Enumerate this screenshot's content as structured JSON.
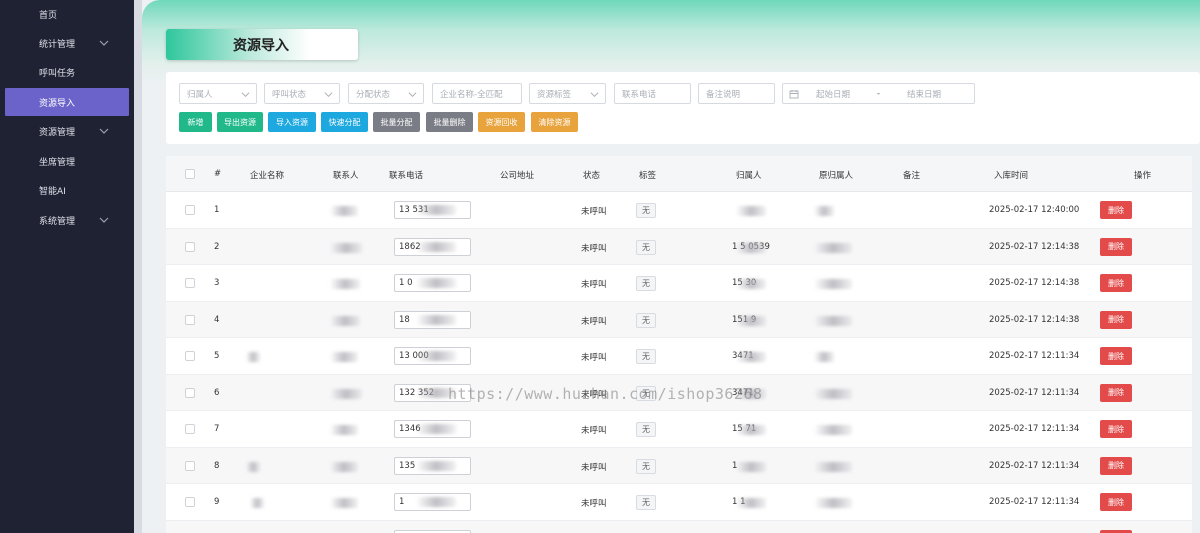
{
  "sidebar": {
    "items": [
      {
        "label": "首页",
        "has_chevron": false
      },
      {
        "label": "统计管理",
        "has_chevron": true
      },
      {
        "label": "呼叫任务",
        "has_chevron": false
      },
      {
        "label": "资源导入",
        "has_chevron": false,
        "active": true
      },
      {
        "label": "资源管理",
        "has_chevron": true
      },
      {
        "label": "坐席管理",
        "has_chevron": false
      },
      {
        "label": "智能AI",
        "has_chevron": false
      },
      {
        "label": "系统管理",
        "has_chevron": true
      }
    ]
  },
  "page": {
    "title": "资源导入"
  },
  "filters": {
    "owner": "归属人",
    "call_status": "呼叫状态",
    "assign_status": "分配状态",
    "company": "企业名称-全匹配",
    "resource_tag": "资源标签",
    "phone": "联系电话",
    "remark": "备注说明",
    "start_date": "起始日期",
    "date_sep": "-",
    "end_date": "结束日期"
  },
  "actions": {
    "add": "新增",
    "export": "导出资源",
    "import": "导入资源",
    "quick_assign": "快速分配",
    "batch_assign": "批量分配",
    "batch_delete": "批量删除",
    "recycle": "资源回收",
    "clear": "清除资源"
  },
  "colors": {
    "sidebar_bg": "#1f2233",
    "active_item": "#6b63c9",
    "btn_green": "#22b98a",
    "btn_blue": "#1ea8e0",
    "btn_gray": "#7a7d85",
    "btn_orange": "#e8a33d",
    "btn_red": "#e34b4b"
  },
  "table": {
    "headers": {
      "index": "#",
      "company": "企业名称",
      "contact": "联系人",
      "phone": "联系电话",
      "address": "公司地址",
      "status": "状态",
      "tag": "标签",
      "owner": "归属人",
      "orig_owner": "原归属人",
      "remark": "备注",
      "time": "入库时间",
      "ops": "操作"
    },
    "rows": [
      {
        "index": "1",
        "phone": "13    531",
        "status": "未呼叫",
        "tag": "无",
        "owner": "",
        "time": "2025-02-17 12:40:00",
        "op": "删除"
      },
      {
        "index": "2",
        "phone": "1862",
        "status": "未呼叫",
        "tag": "无",
        "owner": "1  5  0539",
        "time": "2025-02-17 12:14:38",
        "op": "删除"
      },
      {
        "index": "3",
        "phone": "1    0",
        "status": "未呼叫",
        "tag": "无",
        "owner": "15    30",
        "time": "2025-02-17 12:14:38",
        "op": "删除"
      },
      {
        "index": "4",
        "phone": "18",
        "status": "未呼叫",
        "tag": "无",
        "owner": "151    9",
        "time": "2025-02-17 12:14:38",
        "op": "删除"
      },
      {
        "index": "5",
        "phone": "13    000",
        "status": "未呼叫",
        "tag": "无",
        "owner": "   3471",
        "time": "2025-02-17 12:11:34",
        "op": "删除"
      },
      {
        "index": "6",
        "phone": "132    352",
        "status": "未呼叫",
        "tag": "无",
        "owner": "   3471",
        "time": "2025-02-17 12:11:34",
        "op": "删除"
      },
      {
        "index": "7",
        "phone": "1346",
        "status": "未呼叫",
        "tag": "无",
        "owner": "15    71",
        "time": "2025-02-17 12:11:34",
        "op": "删除"
      },
      {
        "index": "8",
        "phone": "135",
        "status": "未呼叫",
        "tag": "无",
        "owner": "      1",
        "time": "2025-02-17 12:11:34",
        "op": "删除"
      },
      {
        "index": "9",
        "phone": "1",
        "status": "未呼叫",
        "tag": "无",
        "owner": "1    1",
        "time": "2025-02-17 12:11:34",
        "op": "删除"
      }
    ]
  },
  "watermark": "https://www.huzhan.com/ishop36268"
}
